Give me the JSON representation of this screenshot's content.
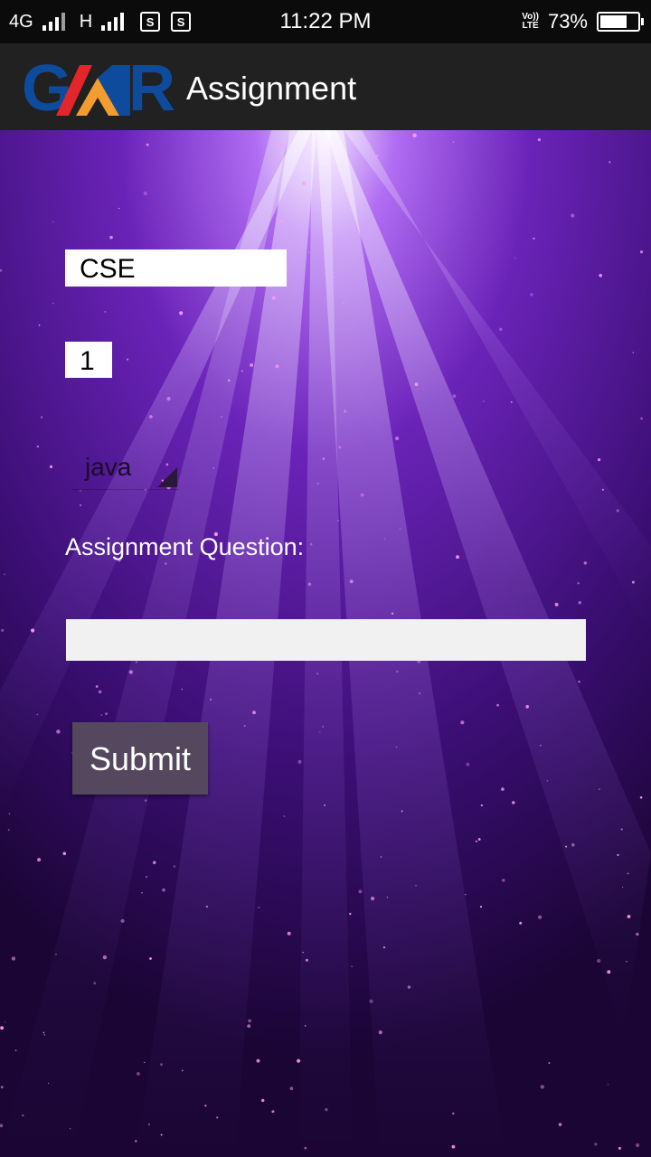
{
  "status_bar": {
    "network1": "4G",
    "network2": "H",
    "notif_icon_label": "S",
    "time": "11:22 PM",
    "volte_top": "Vo))",
    "volte_bottom": "LTE",
    "battery_percent_text": "73%",
    "battery_level": 0.73
  },
  "app_bar": {
    "logo_text": "GMR",
    "title": "Assignment",
    "colors": {
      "logo_blue": "#0e4b9c",
      "logo_red": "#e2262b",
      "logo_orange": "#f39c2f"
    }
  },
  "form": {
    "department_value": "CSE",
    "semester_value": "1",
    "subject_selected": "java",
    "question_label": "Assignment Question:",
    "question_value": "",
    "submit_label": "Submit"
  },
  "colors": {
    "background_dark": "#1b0636",
    "background_ray": "#b26bff",
    "appbar": "#212121",
    "submit_bg": "#55475e"
  }
}
